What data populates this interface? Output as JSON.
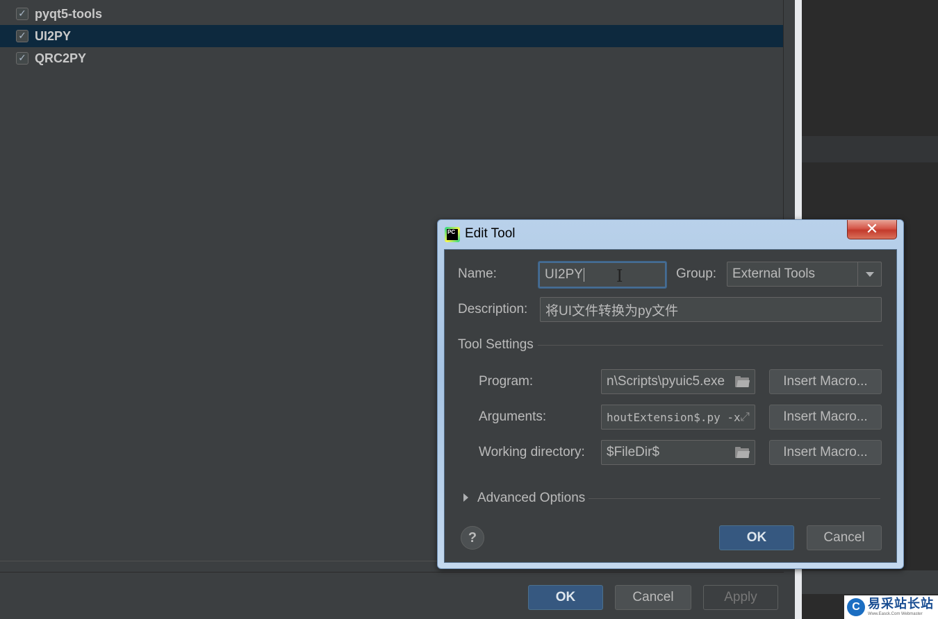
{
  "tools_list": {
    "items": [
      {
        "label": "pyqt5-tools",
        "checked": true,
        "selected": false
      },
      {
        "label": "UI2PY",
        "checked": true,
        "selected": true
      },
      {
        "label": "QRC2PY",
        "checked": true,
        "selected": false
      }
    ]
  },
  "settings_footer": {
    "ok": "OK",
    "cancel": "Cancel",
    "apply": "Apply"
  },
  "dialog": {
    "title": "Edit Tool",
    "app_icon_text": "PC",
    "close_glyph": "✕",
    "name_label": "Name:",
    "name_value": "UI2PY",
    "group_label": "Group:",
    "group_value": "External Tools",
    "description_label": "Description:",
    "description_value": "将UI文件转换为py文件",
    "tool_settings_title": "Tool Settings",
    "program_label": "Program:",
    "program_value": "n\\Scripts\\pyuic5.exe",
    "arguments_label": "Arguments:",
    "arguments_value": "houtExtension$.py -x",
    "working_dir_label": "Working directory:",
    "working_dir_value": "$FileDir$",
    "insert_macro": "Insert Macro...",
    "advanced_options": "Advanced Options",
    "help_glyph": "?",
    "ok": "OK",
    "cancel": "Cancel"
  },
  "watermark": {
    "logo": "C",
    "text": "易采站长站",
    "sub": "Www.Easck.Com  Webmaster"
  },
  "colors": {
    "selection": "#0d293e",
    "default_button": "#365880",
    "panel": "#3c3f41"
  }
}
